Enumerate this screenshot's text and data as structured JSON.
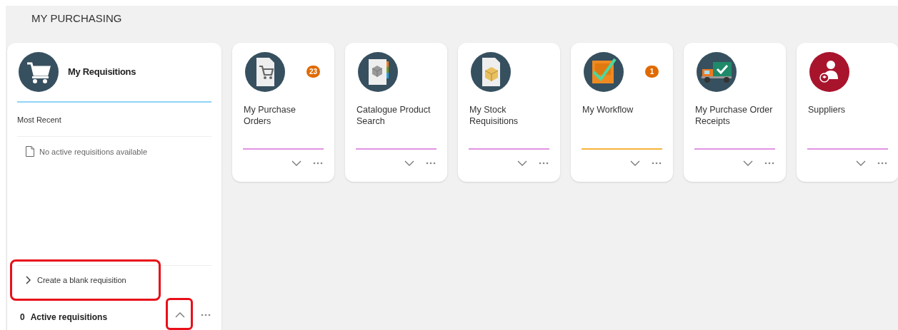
{
  "page_title": "MY PURCHASING",
  "requisitions": {
    "title": "My Requisitions",
    "section": "Most Recent",
    "empty_message": "No active requisitions available",
    "create_link": "Create a blank requisition",
    "count": "0",
    "count_label": "Active requisitions",
    "expanded": true
  },
  "tiles": [
    {
      "kind": "purchase-orders",
      "title": "My Purchase Orders",
      "badge": "23",
      "color": "#e293e2"
    },
    {
      "kind": "catalogue",
      "title": "Catalogue Product Search",
      "color": "#e293e2"
    },
    {
      "kind": "stock",
      "title": "My Stock Requisitions",
      "color": "#e293e2"
    },
    {
      "kind": "workflow",
      "title": "My Workflow",
      "badge": "1",
      "color": "#f7b23b"
    },
    {
      "kind": "receipts",
      "title": "My Purchase Order Receipts",
      "color": "#e293e2"
    },
    {
      "kind": "suppliers",
      "title": "Suppliers",
      "color": "#e293e2"
    }
  ]
}
